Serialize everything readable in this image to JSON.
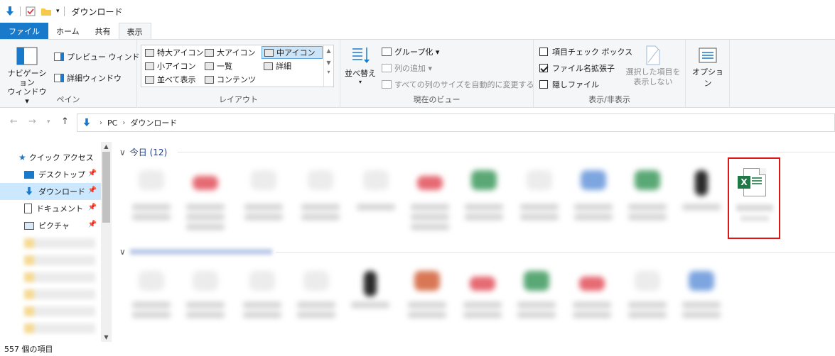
{
  "window": {
    "title": "ダウンロード"
  },
  "tabs": [
    {
      "label": "ファイル"
    },
    {
      "label": "ホーム"
    },
    {
      "label": "共有"
    },
    {
      "label": "表示"
    }
  ],
  "ribbon": {
    "pane": {
      "label": "ペイン",
      "nav_pane": "ナビゲーション\nウィンドウ ▾",
      "preview": "プレビュー ウィンドウ",
      "details": "詳細ウィンドウ"
    },
    "layout": {
      "label": "レイアウト",
      "options": [
        "特大アイコン",
        "大アイコン",
        "中アイコン",
        "小アイコン",
        "一覧",
        "詳細",
        "並べて表示",
        "コンテンツ"
      ],
      "selected": "中アイコン"
    },
    "current_view": {
      "label": "現在のビュー",
      "sort": "並べ替え",
      "group_by": "グループ化 ▾",
      "add_columns": "列の追加 ▾",
      "size_all": "すべての列のサイズを自動的に変更する"
    },
    "show_hide": {
      "label": "表示/非表示",
      "item_checkboxes": {
        "label": "項目チェック ボックス",
        "checked": false
      },
      "file_extensions": {
        "label": "ファイル名拡張子",
        "checked": true
      },
      "hidden_items": {
        "label": "隠しファイル",
        "checked": false
      },
      "hide_selected": "選択した項目を\n表示しない"
    },
    "options": {
      "label": "オプション"
    }
  },
  "address": {
    "crumbs": [
      "PC",
      "ダウンロード"
    ]
  },
  "sidebar": {
    "items": [
      {
        "label": "クイック アクセス"
      },
      {
        "label": "デスクトップ"
      },
      {
        "label": "ダウンロード"
      },
      {
        "label": "ドキュメント"
      },
      {
        "label": "ピクチャ"
      }
    ]
  },
  "content": {
    "group_today": "今日 (12)",
    "excel_badge": "X"
  },
  "status": {
    "item_count": "557 個の項目"
  },
  "colors": {
    "accent": "#1979ca",
    "excel_green": "#1d7a45",
    "highlight_red": "#e01515",
    "selected_bg": "#cce8ff"
  }
}
